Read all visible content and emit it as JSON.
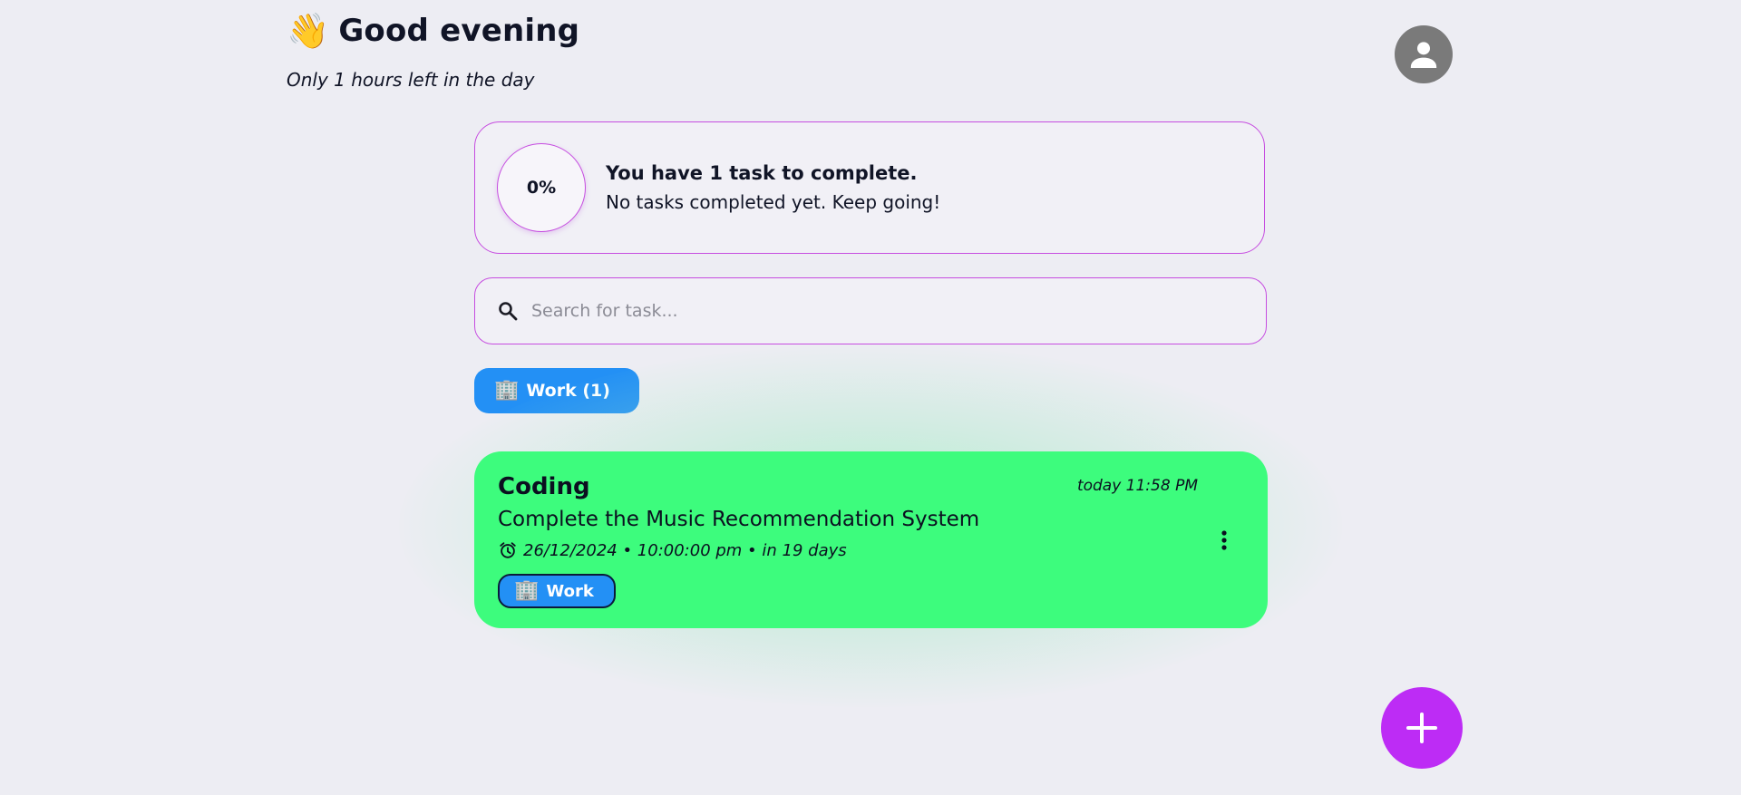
{
  "header": {
    "wave_emoji": "👋",
    "greeting": "Good evening",
    "subtitle": "Only 1 hours left in the day",
    "avatar_icon": "user-icon"
  },
  "progress": {
    "percent_label": "0%",
    "percent_value": 0,
    "headline": "You have 1 task to complete.",
    "message": "No tasks completed yet. Keep going!"
  },
  "search": {
    "placeholder": "Search for task...",
    "value": "",
    "icon": "search-icon"
  },
  "categories": [
    {
      "emoji": "🏢",
      "label": "Work (1)",
      "color": "#2390f5"
    }
  ],
  "tasks": [
    {
      "title": "Coding",
      "created": "today 11:58 PM",
      "description": "Complete the Music Recommendation System",
      "due": "26/12/2024 • 10:00:00 pm • in 19 days",
      "tag_emoji": "🏢",
      "tag_label": "Work",
      "color": "#3dfc7d"
    }
  ],
  "fab": {
    "icon": "plus-icon"
  },
  "colors": {
    "accent": "#bd2cf5",
    "border": "#c64de0",
    "category": "#2390f5",
    "task": "#3dfc7d",
    "background": "#ededf3"
  }
}
